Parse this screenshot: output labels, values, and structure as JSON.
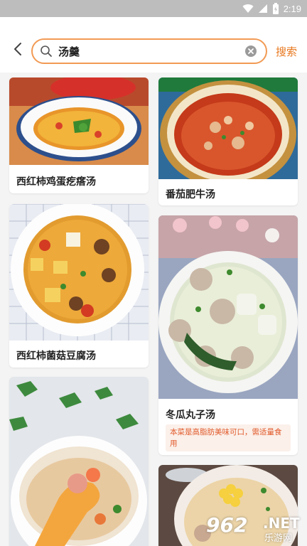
{
  "status_bar": {
    "time": "2:19"
  },
  "search": {
    "query": "汤羹",
    "button_label": "搜索"
  },
  "cards": [
    {
      "title": "西红柿鸡蛋疙瘩汤",
      "image": "tomato-egg-soup"
    },
    {
      "title": "番茄肥牛汤",
      "image": "tomato-beef-soup"
    },
    {
      "title": "西红柿菌菇豆腐汤",
      "image": "tomato-mushroom-tofu-soup"
    },
    {
      "title": "冬瓜丸子汤",
      "image": "winter-melon-meatball-soup",
      "description": "本菜是高脂肪美味可口，需适量食用"
    },
    {
      "title": "",
      "image": "pork-rib-soup"
    },
    {
      "title": "",
      "image": "corn-rib-soup"
    }
  ],
  "watermark": {
    "logo": "962",
    "net": ".NET",
    "sub": "乐游网"
  },
  "colors": {
    "accent": "#e8781e",
    "search_border": "#f29a54",
    "status_bar": "#bdbdbd"
  }
}
